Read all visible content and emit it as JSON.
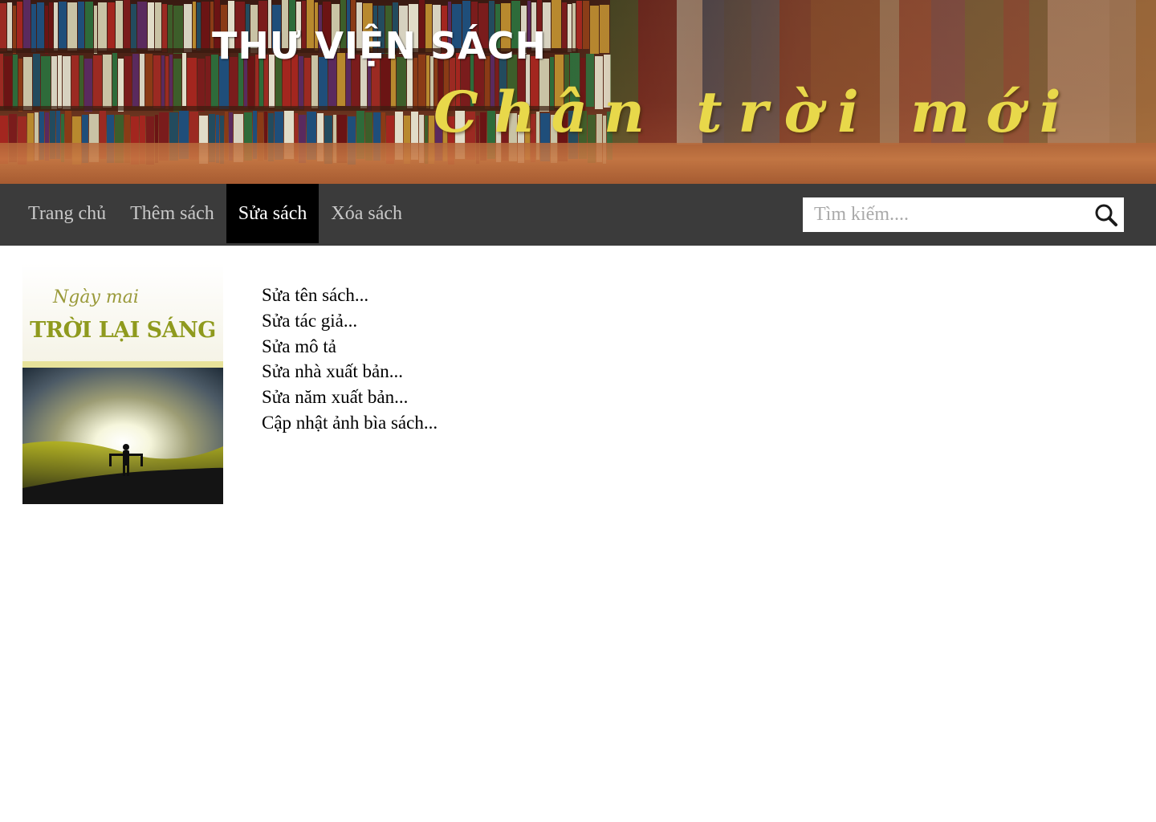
{
  "header": {
    "site_title": "THƯ VIỆN SÁCH",
    "slogan": "Chân trời mới"
  },
  "nav": {
    "items": [
      {
        "label": "Trang chủ",
        "active": false
      },
      {
        "label": "Thêm sách",
        "active": false
      },
      {
        "label": "Sửa sách",
        "active": true
      },
      {
        "label": "Xóa sách",
        "active": false
      }
    ],
    "search": {
      "placeholder": "Tìm kiếm....",
      "value": "",
      "icon": "search-icon"
    }
  },
  "book_cover": {
    "script_title": "Ngày mai",
    "title": "TRỜI LẠI SÁNG"
  },
  "edit_options": [
    "Sửa tên sách...",
    "Sửa tác giả...",
    "Sửa mô tả",
    "Sửa nhà xuất bản...",
    "Sửa năm xuất bản...",
    "Cập nhật ảnh bìa sách..."
  ],
  "colors": {
    "navbar": "#3b3b3b",
    "nav_active": "#000000",
    "slogan": "#e8d84a",
    "cover_title": "#8f9a1e"
  }
}
